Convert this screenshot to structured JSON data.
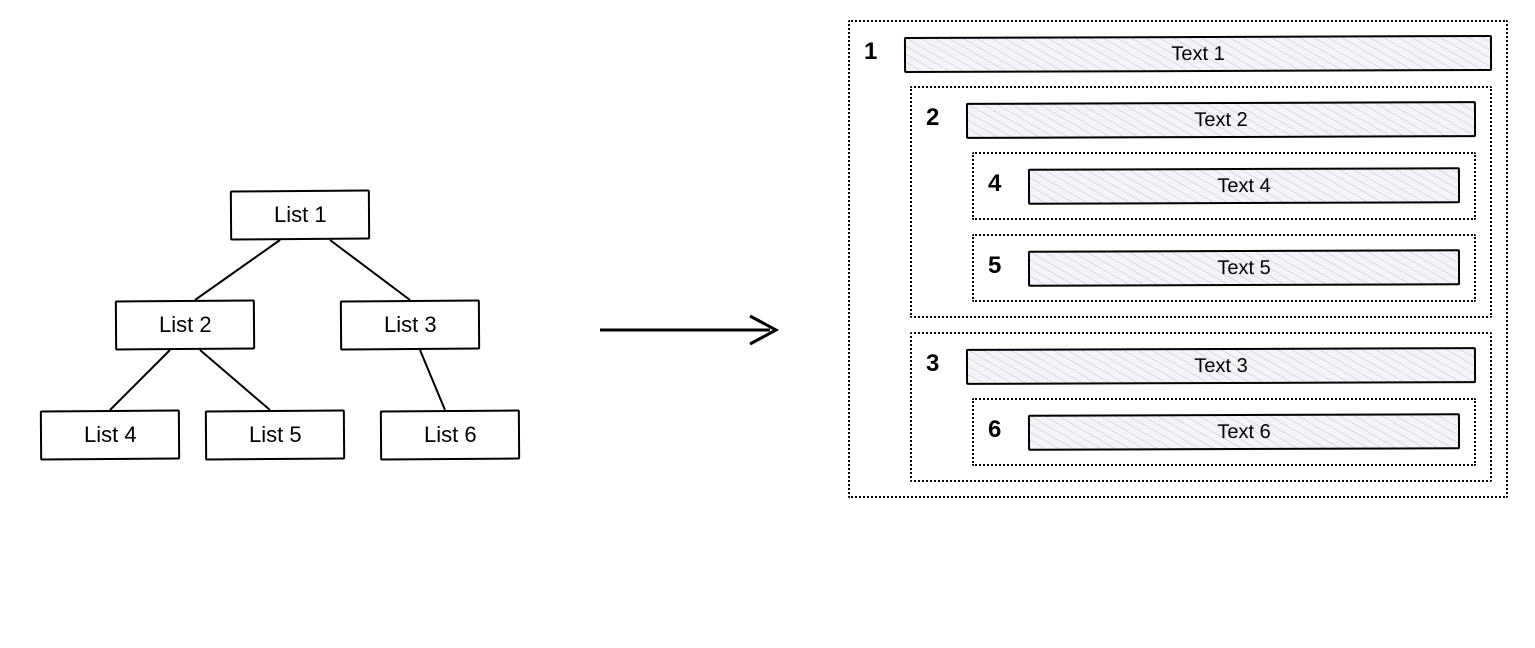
{
  "tree": {
    "n1": "List 1",
    "n2": "List 2",
    "n3": "List 3",
    "n4": "List 4",
    "n5": "List 5",
    "n6": "List 6"
  },
  "list": {
    "g1": {
      "num": "1",
      "text": "Text 1"
    },
    "g2": {
      "num": "2",
      "text": "Text 2"
    },
    "g3": {
      "num": "3",
      "text": "Text 3"
    },
    "g4": {
      "num": "4",
      "text": "Text 4"
    },
    "g5": {
      "num": "5",
      "text": "Text 5"
    },
    "g6": {
      "num": "6",
      "text": "Text 6"
    }
  }
}
